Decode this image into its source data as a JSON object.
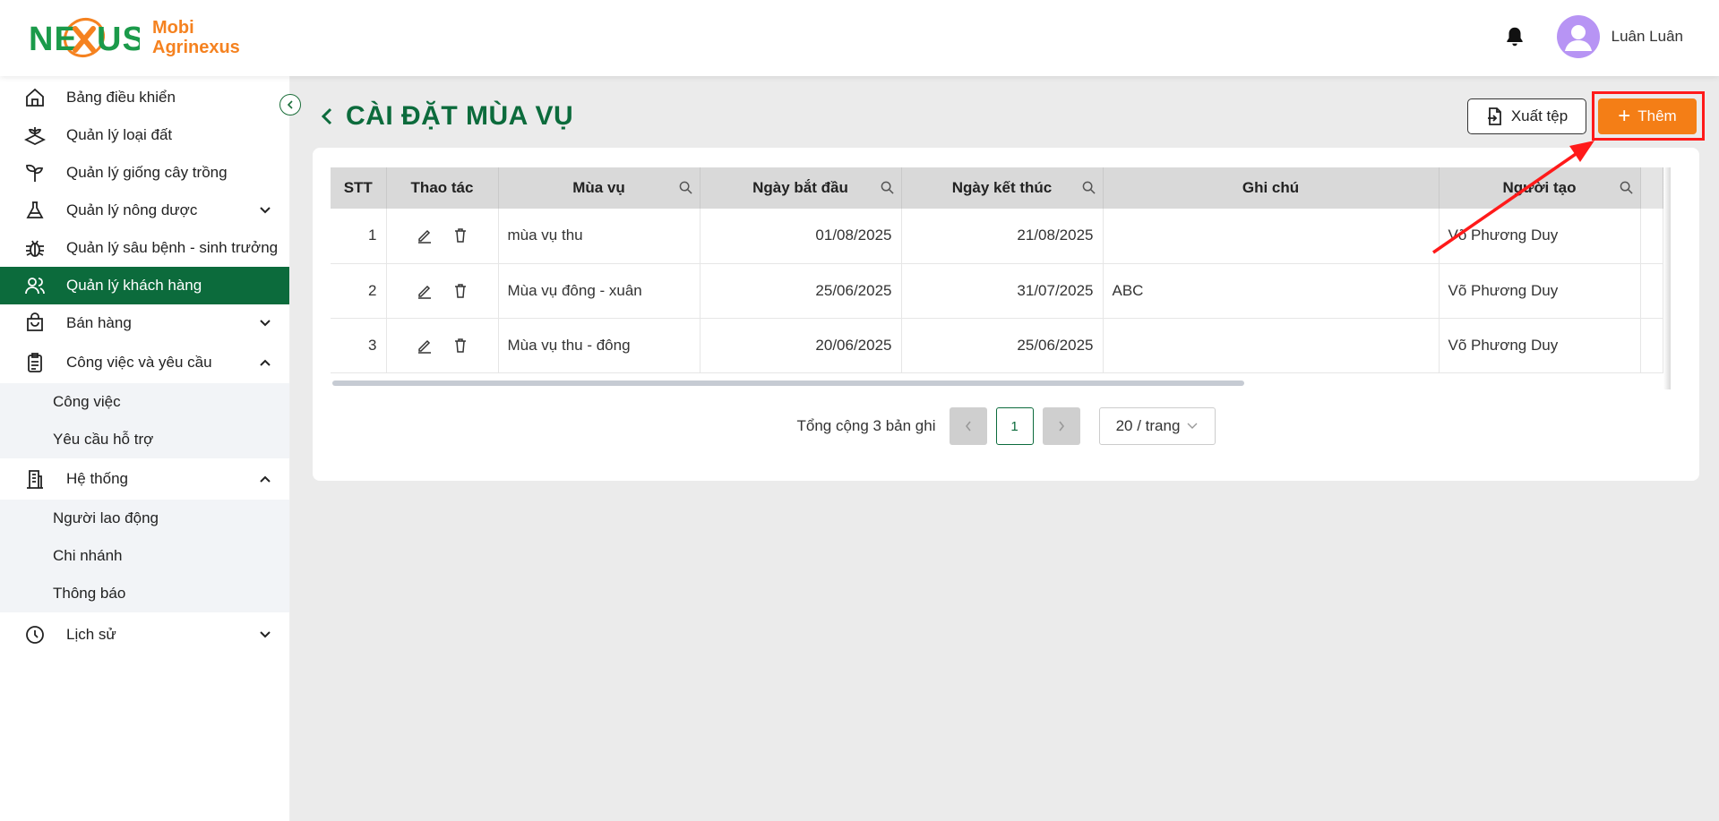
{
  "brand": {
    "line1": "Mobi",
    "line2": "Agrinexus",
    "logo_text": "NEXUS",
    "logo_color": "#0c6b3c",
    "accent_color": "#f58220"
  },
  "header": {
    "user_name": "Luân Luân",
    "bell_icon": "bell-icon",
    "avatar_icon": "user-avatar-icon"
  },
  "sidebar": {
    "items": [
      {
        "label": "Bảng điều khiển",
        "icon": "home-icon"
      },
      {
        "label": "Quản lý loại đất",
        "icon": "land-icon"
      },
      {
        "label": "Quản lý giống cây trồng",
        "icon": "plant-icon"
      },
      {
        "label": "Quản lý nông dược",
        "icon": "flask-icon"
      },
      {
        "label": "Quản lý sâu bệnh - sinh trưởng",
        "icon": "bug-icon"
      },
      {
        "label": "Quản lý khách hàng",
        "icon": "users-icon",
        "active": true
      },
      {
        "label": "Bán hàng",
        "icon": "bag-icon"
      },
      {
        "label": "Công việc và yêu cầu",
        "icon": "clipboard-icon"
      },
      {
        "label": "Hệ thống",
        "icon": "building-icon"
      },
      {
        "label": "Lịch sử",
        "icon": "clock-icon"
      }
    ],
    "work_sub": [
      "Công việc",
      "Yêu cầu hỗ trợ"
    ],
    "system_sub": [
      "Người lao động",
      "Chi nhánh",
      "Thông báo"
    ]
  },
  "page": {
    "title": "CÀI ĐẶT MÙA VỤ",
    "export_label": "Xuất tệp",
    "add_label": "Thêm",
    "add_color": "#f47e16",
    "highlight_color": "#ff1a1a"
  },
  "table": {
    "columns": [
      "STT",
      "Thao tác",
      "Mùa vụ",
      "Ngày bắt đầu",
      "Ngày kết thúc",
      "Ghi chú",
      "Người tạo"
    ],
    "rows": [
      {
        "stt": "1",
        "season": "mùa vụ thu",
        "start": "01/08/2025",
        "end": "21/08/2025",
        "note": "",
        "creator": "Võ Phương Duy"
      },
      {
        "stt": "2",
        "season": "Mùa vụ đông - xuân",
        "start": "25/06/2025",
        "end": "31/07/2025",
        "note": "ABC",
        "creator": "Võ Phương Duy"
      },
      {
        "stt": "3",
        "season": "Mùa vụ thu - đông",
        "start": "20/06/2025",
        "end": "25/06/2025",
        "note": "",
        "creator": "Võ Phương Duy"
      }
    ]
  },
  "pagination": {
    "total_text": "Tổng cộng 3 bản ghi",
    "current_page": "1",
    "page_size": "20 / trang"
  }
}
